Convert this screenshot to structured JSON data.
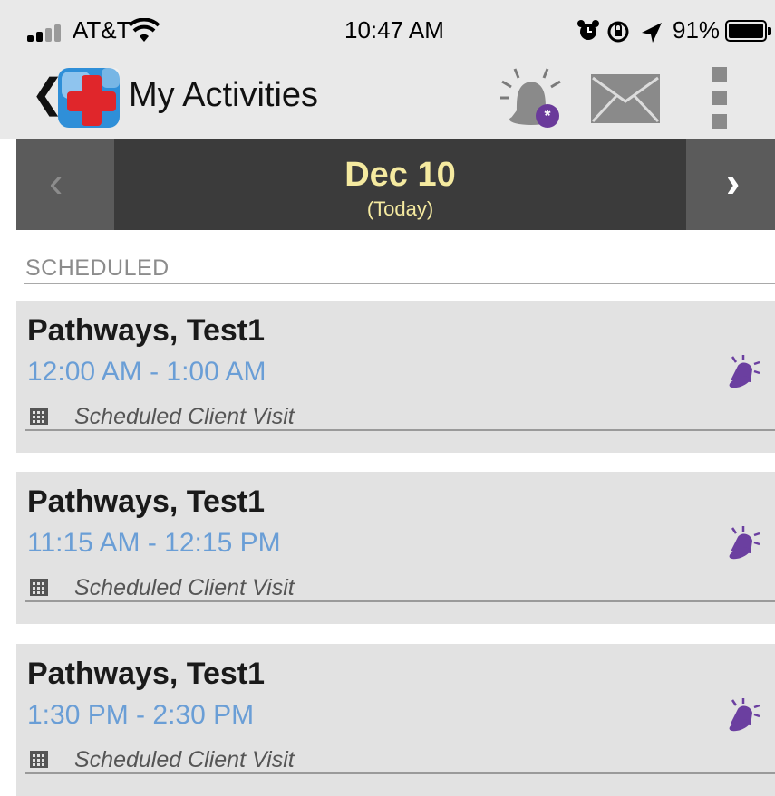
{
  "status_bar": {
    "carrier": "AT&T",
    "time": "10:47 AM",
    "battery_percent": "91%",
    "battery_level": 0.91,
    "icons": [
      "signal-icon",
      "wifi-icon",
      "alarm-clock-icon",
      "rotation-lock-icon",
      "location-icon",
      "battery-icon"
    ]
  },
  "header": {
    "title": "My Activities",
    "icons": [
      "back-chevron-icon",
      "app-logo-icon",
      "notification-bell-icon",
      "mail-icon",
      "more-vertical-icon"
    ],
    "colors": {
      "logo_blue": "#2f8fd8",
      "logo_red": "#e0262b",
      "bell_badge": "#6a3a9a"
    }
  },
  "date_nav": {
    "date": "Dec 10",
    "subtitle": "(Today)",
    "prev_icon": "chevron-left-icon",
    "next_icon": "chevron-right-icon",
    "colors": {
      "date_text": "#f5eaa0",
      "bar": "#3b3b3b",
      "buttons": "#5b5b5b"
    }
  },
  "section": {
    "label": "SCHEDULED"
  },
  "activities": [
    {
      "name": "Pathways, Test1",
      "time_range": "12:00 AM - 1:00 AM",
      "type": "Scheduled Client Visit"
    },
    {
      "name": "Pathways, Test1",
      "time_range": "11:15 AM - 12:15 PM",
      "type": "Scheduled Client Visit"
    },
    {
      "name": "Pathways, Test1",
      "time_range": "1:30 PM - 2:30 PM",
      "type": "Scheduled Client Visit"
    }
  ],
  "colors": {
    "time_text": "#6a9ed6",
    "alarm_purple": "#6b3fa0"
  }
}
